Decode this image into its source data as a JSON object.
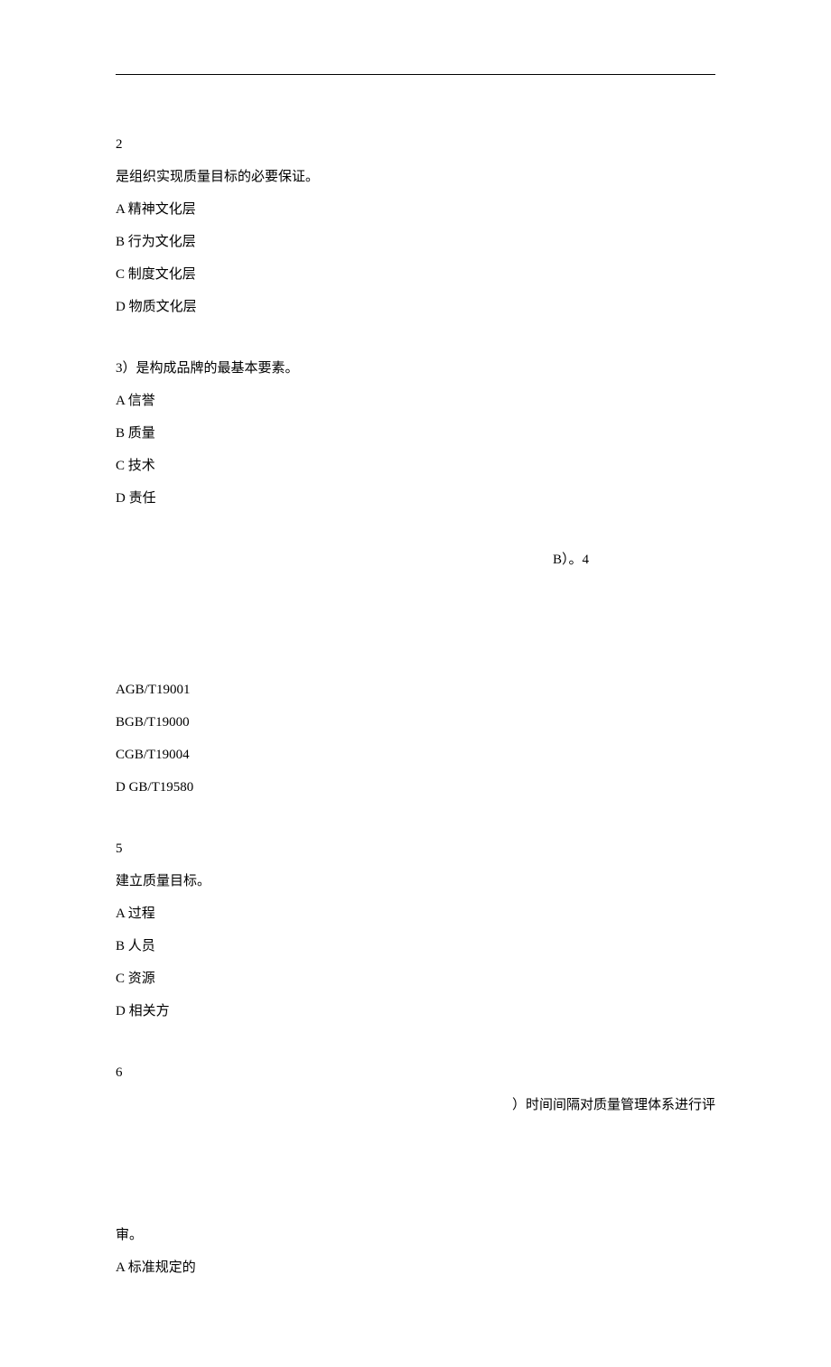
{
  "questions": [
    {
      "num": "2",
      "stem": "是组织实现质量目标的必要保证。",
      "options": [
        "A 精神文化层",
        "B 行为文化层",
        "C 制度文化层",
        "D 物质文化层"
      ]
    },
    {
      "num": "3",
      "stem_inline": "）是构成品牌的最基本要素。",
      "options": [
        "A 信誉",
        "B 质量",
        "C 技术",
        "D 责任"
      ]
    },
    {
      "num_right": "B）。4",
      "options": [
        "AGB/T19001",
        "BGB/T19000",
        "CGB/T19004",
        "D GB/T19580"
      ]
    },
    {
      "num": "5",
      "stem": "建立质量目标。",
      "options": [
        "A 过程",
        "B 人员",
        "C 资源",
        "D 相关方"
      ]
    },
    {
      "num": "6",
      "stem_right": "）时间间隔对质量管理体系进行评",
      "stem2": "审。",
      "options": [
        "A 标准规定的"
      ]
    }
  ]
}
